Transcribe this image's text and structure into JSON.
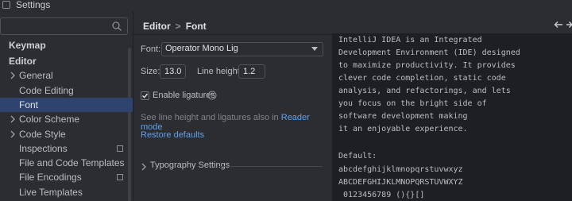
{
  "window": {
    "title": "Settings"
  },
  "search": {
    "placeholder": ""
  },
  "sidebar": {
    "items": [
      {
        "label": "Keymap"
      },
      {
        "label": "Editor"
      },
      {
        "label": "General"
      },
      {
        "label": "Code Editing"
      },
      {
        "label": "Font"
      },
      {
        "label": "Color Scheme"
      },
      {
        "label": "Code Style"
      },
      {
        "label": "Inspections"
      },
      {
        "label": "File and Code Templates"
      },
      {
        "label": "File Encodings"
      },
      {
        "label": "Live Templates"
      }
    ]
  },
  "breadcrumb": {
    "parent": "Editor",
    "separator": ">",
    "current": "Font"
  },
  "font": {
    "label": "Font:",
    "value": "Operator Mono Lig",
    "size_label": "Size:",
    "size_value": "13.0",
    "line_height_label": "Line height:",
    "line_height_value": "1.2",
    "ligatures_label": "Enable ligatures",
    "ligatures_checked": true,
    "note_text": "See line height and ligatures also in",
    "note_link": "Reader mode",
    "restore_label": "Restore defaults",
    "typography_label": "Typography Settings"
  },
  "preview": {
    "lines": [
      "IntelliJ IDEA is an Integrated",
      "Development Environment (IDE) designed",
      "to maximize productivity. It provides",
      "clever code completion, static code",
      "analysis, and refactorings, and lets",
      "you focus on the bright side of",
      "software development making",
      "it an enjoyable experience.",
      "",
      "Default:",
      "abcdefghijklmnopqrstuvwxyz",
      "ABCDEFGHIJKLMNOPQRSTUVWXYZ",
      " 0123456789 (){}[]"
    ]
  },
  "icons": {
    "search": "search-icon",
    "help": "question-circle-icon",
    "back": "back-arrow-icon",
    "forward": "forward-arrow-icon",
    "accent": "#5e9ff0",
    "selected_bg": "#2e436e"
  }
}
